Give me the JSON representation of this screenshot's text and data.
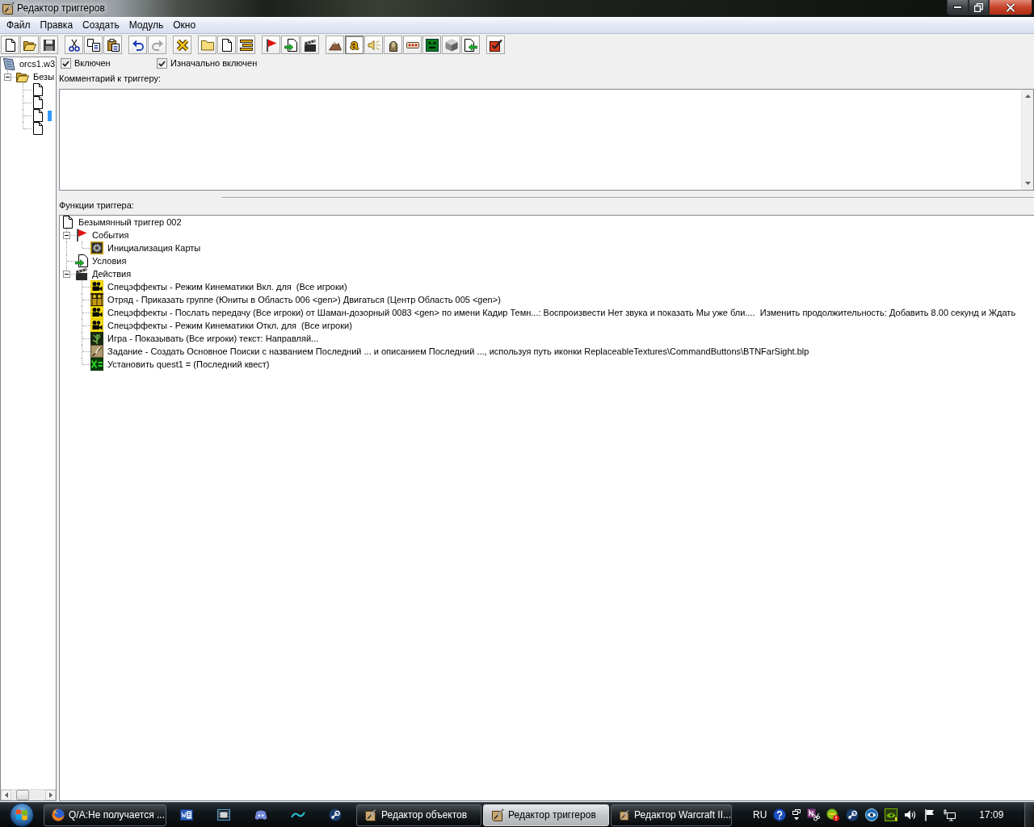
{
  "window": {
    "title": "Редактор триггеров"
  },
  "menu": [
    {
      "label": "Файл"
    },
    {
      "label": "Правка"
    },
    {
      "label": "Создать"
    },
    {
      "label": "Модуль"
    },
    {
      "label": "Окно"
    }
  ],
  "toolbar": [
    {
      "buttons": [
        {
          "pressed": false,
          "disabled": false
        },
        {
          "pressed": false,
          "disabled": false
        },
        {
          "pressed": false,
          "disabled": false
        }
      ]
    },
    {
      "buttons": [
        {
          "pressed": false,
          "disabled": false
        },
        {
          "pressed": false,
          "disabled": false
        },
        {
          "pressed": false,
          "disabled": false
        }
      ]
    },
    {
      "buttons": [
        {
          "pressed": false,
          "disabled": false
        },
        {
          "pressed": false,
          "disabled": true
        }
      ]
    },
    {
      "buttons": [
        {
          "pressed": false,
          "disabled": false
        }
      ]
    },
    {
      "buttons": [
        {
          "pressed": false,
          "disabled": false
        },
        {
          "pressed": false,
          "disabled": false
        },
        {
          "pressed": false,
          "disabled": false
        }
      ]
    },
    {
      "buttons": [
        {
          "pressed": false,
          "disabled": false
        },
        {
          "pressed": false,
          "disabled": false
        },
        {
          "pressed": false,
          "disabled": false
        }
      ]
    },
    {
      "buttons": [
        {
          "pressed": false,
          "disabled": false
        },
        {
          "label": "a",
          "pressed": true,
          "disabled": false
        },
        {
          "pressed": false,
          "disabled": false
        },
        {
          "pressed": false,
          "disabled": false
        },
        {
          "pressed": false,
          "disabled": false
        },
        {
          "pressed": false,
          "disabled": false
        },
        {
          "pressed": false,
          "disabled": false
        },
        {
          "pressed": false,
          "disabled": false
        }
      ]
    },
    {
      "buttons": [
        {
          "pressed": false,
          "disabled": false
        }
      ]
    }
  ],
  "map_tree": {
    "kind": "map",
    "label": "orcs1.w3",
    "children": [
      {
        "kind": "folder",
        "label": "Безы",
        "expanded": true,
        "children": [
          {
            "kind": "trigger",
            "selected": false
          },
          {
            "kind": "trigger",
            "selected": false
          },
          {
            "kind": "trigger",
            "selected": true
          },
          {
            "kind": "trigger",
            "selected": false
          }
        ]
      }
    ]
  },
  "trigger": {
    "enabled": {
      "label": "Включен",
      "checked": true
    },
    "initially_on": {
      "label": "Изначально включен",
      "checked": true
    },
    "comment_label": "Комментарий к триггеру:"
  },
  "functions": {
    "label": "Функции триггера:",
    "tree": {
      "kind": "trigger",
      "label": "Безымянный триггер 002",
      "children": [
        {
          "kind": "events",
          "label": "События",
          "expanded": true,
          "children": [
            {
              "kind": "init",
              "label": "Инициализация Карты"
            }
          ]
        },
        {
          "kind": "conditions",
          "label": "Условия"
        },
        {
          "kind": "actions",
          "label": "Действия",
          "expanded": true,
          "children": [
            {
              "kind": "cinematic",
              "label": "Спецэффекты - Режим Кинематики Вкл. для  (Все игроки)"
            },
            {
              "kind": "unit",
              "label": "Отряд - Приказать группе (Юниты в Область 006 <gen>) Двигаться (Центр Область 005 <gen>)"
            },
            {
              "kind": "cinematic",
              "label": "Спецэффекты - Послать передачу (Все игроки) от Шаман-дозорный 0083 <gen> по имени Кадир Темн...: Воспроизвести Нет звука и показать Мы уже бли....  Изменить продолжительность: Добавить 8.00 секунд и Ждать"
            },
            {
              "kind": "cinematic",
              "label": "Спецэффекты - Режим Кинематики Откл. для  (Все игроки)"
            },
            {
              "kind": "game",
              "label": "Игра - Показывать (Все игроки) текст: Направляй..."
            },
            {
              "kind": "quest",
              "label": "Задание - Создать Основное Поиски с названием Последний ... и описанием Последний ..., используя путь иконки ReplaceableTextures\\CommandButtons\\BTNFarSight.blp"
            },
            {
              "kind": "variable",
              "label": "Установить quest1 = (Последний квест)"
            }
          ]
        }
      ]
    }
  },
  "taskbar": {
    "buttons": [
      {
        "kind": "browser",
        "label": "Q/A:Не получается ...",
        "selected": false
      },
      {
        "kind": "editor",
        "label": "Редактор объектов",
        "selected": false
      },
      {
        "kind": "editor",
        "label": "Редактор триггеров",
        "selected": true
      },
      {
        "kind": "editor",
        "label": "Редактор Warcraft II...",
        "selected": false
      }
    ],
    "language": "RU",
    "clock": "17:09"
  }
}
